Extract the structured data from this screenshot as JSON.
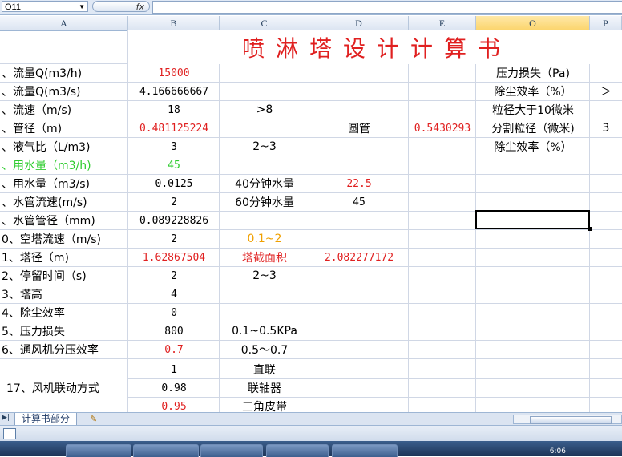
{
  "namebox": "O11",
  "fx_label": "fx",
  "columns": [
    "A",
    "B",
    "C",
    "D",
    "E",
    "O",
    "P"
  ],
  "title": "喷淋塔设计计算书",
  "rows": [
    {
      "a": "、流量Q(m3/h)",
      "b": "15000",
      "c": "",
      "d": "",
      "e": "",
      "o": "压力损失（Pa)"
    },
    {
      "a": "、流量Q(m3/s)",
      "b": "4.166666667",
      "c": "",
      "d": "",
      "e": "",
      "o": "除尘效率（%）",
      "p": "＞"
    },
    {
      "a": "、流速（m/s)",
      "b": "18",
      "c": ">8",
      "d": "",
      "e": "",
      "o": "粒径大于10微米"
    },
    {
      "a": "、管径（m)",
      "b": "0.481125224",
      "c": "",
      "d": "圆管",
      "e": "0.5430293",
      "o": "分割粒径（微米)",
      "p": "3"
    },
    {
      "a": "、液气比（L/m3)",
      "b": "3",
      "c": "2~3",
      "d": "",
      "e": "",
      "o": "除尘效率（%）"
    },
    {
      "a": "、用水量（m3/h)",
      "b": "45",
      "c": "",
      "d": "",
      "e": "",
      "o": ""
    },
    {
      "a": "、用水量（m3/s)",
      "b": "0.0125",
      "c": "40分钟水量",
      "d": "22.5",
      "e": "",
      "o": ""
    },
    {
      "a": "、水管流速(m/s)",
      "b": "2",
      "c": "60分钟水量",
      "d": "45",
      "e": "",
      "o": ""
    },
    {
      "a": "、水管管径（mm)",
      "b": "0.089228826",
      "c": "",
      "d": "",
      "e": "",
      "o": ""
    },
    {
      "a": "0、空塔流速（m/s)",
      "b": "2",
      "c": "0.1~2",
      "d": "",
      "e": "",
      "o": ""
    },
    {
      "a": "1、塔径（m)",
      "b": "1.62867504",
      "c": "塔截面积",
      "d": "2.082277172",
      "e": "",
      "o": ""
    },
    {
      "a": "2、停留时间（s)",
      "b": "2",
      "c": "2~3",
      "d": "",
      "e": "",
      "o": ""
    },
    {
      "a": "3、塔高",
      "b": "4",
      "c": "",
      "d": "",
      "e": "",
      "o": ""
    },
    {
      "a": "4、除尘效率",
      "b": "0",
      "c": "",
      "d": "",
      "e": "",
      "o": ""
    },
    {
      "a": "5、压力损失",
      "b": "800",
      "c": "0.1~0.5KPa",
      "d": "",
      "e": "",
      "o": ""
    },
    {
      "a": "6、通风机分压效率",
      "b": "0.7",
      "c": "0.5～0.7",
      "d": "",
      "e": "",
      "o": ""
    }
  ],
  "fan": {
    "label": "17、风机联动方式",
    "rows": [
      {
        "b": "1",
        "c": "直联"
      },
      {
        "b": "0.98",
        "c": "联轴器"
      },
      {
        "b": "0.95",
        "c": "三角皮带"
      }
    ]
  },
  "sheet_tab": "计算书部分",
  "clock": "6:06",
  "colors": {
    "red": "#e02020",
    "green": "#2ecc2e",
    "orange": "#f0a000"
  }
}
